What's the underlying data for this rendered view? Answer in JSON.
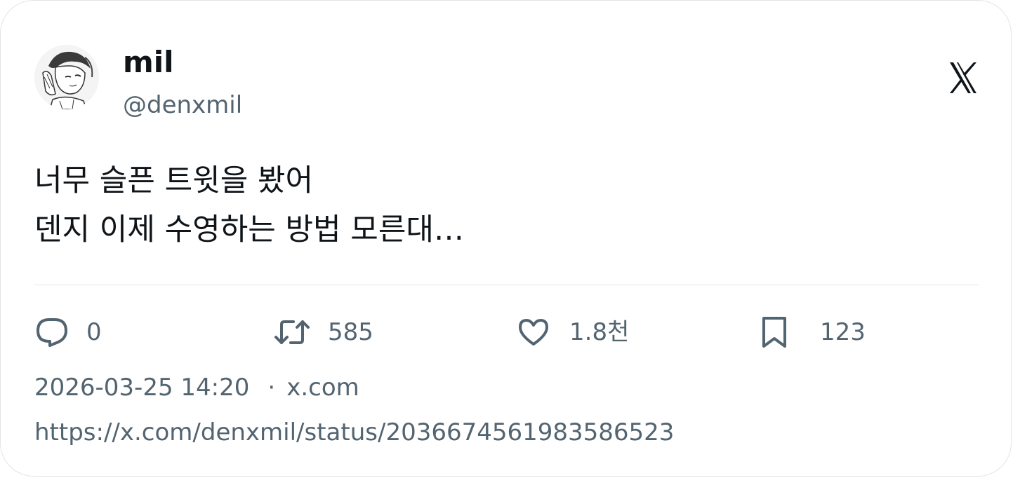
{
  "author": {
    "display_name": "mil",
    "handle": "@denxmil",
    "avatar_icon": "manga-portrait-avatar"
  },
  "platform_icon": "x-logo-icon",
  "tweet": {
    "lines": [
      "너무 슬픈 트윗을 봤어",
      "덴지 이제 수영하는 방법 모른대…"
    ]
  },
  "stats": {
    "replies": "0",
    "retweets": "585",
    "likes": "1.8천",
    "bookmarks": "123"
  },
  "meta": {
    "timestamp": "2026-03-25 14:20",
    "separator": "·",
    "source": "x.com",
    "url": "https://x.com/denxmil/status/2036674561983586523"
  },
  "colors": {
    "text_primary": "#0f1419",
    "text_secondary": "#536471",
    "border": "#e1e4e8"
  }
}
